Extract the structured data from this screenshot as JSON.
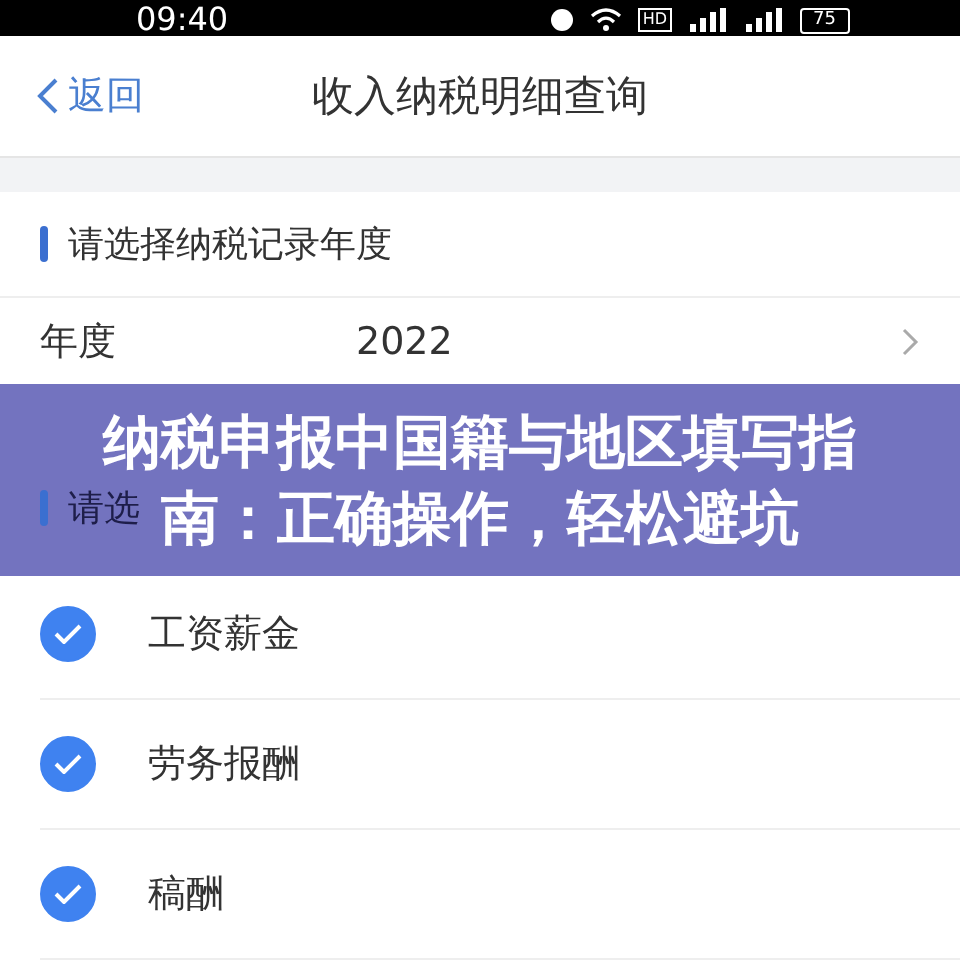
{
  "status_bar": {
    "time": "09:40",
    "network_badge": "HD",
    "battery": "75"
  },
  "nav": {
    "back": "返回",
    "title": "收入纳税明细查询"
  },
  "year_section": {
    "header": "请选择纳税记录年度",
    "label": "年度",
    "value": "2022"
  },
  "type_section": {
    "header": "请选"
  },
  "income_types": [
    {
      "label": "工资薪金",
      "checked": true
    },
    {
      "label": "劳务报酬",
      "checked": true
    },
    {
      "label": "稿酬",
      "checked": true
    }
  ],
  "banner": {
    "lines": [
      "纳税申报中国籍与地区填写指",
      "南：正确操作，轻松避坑"
    ]
  }
}
